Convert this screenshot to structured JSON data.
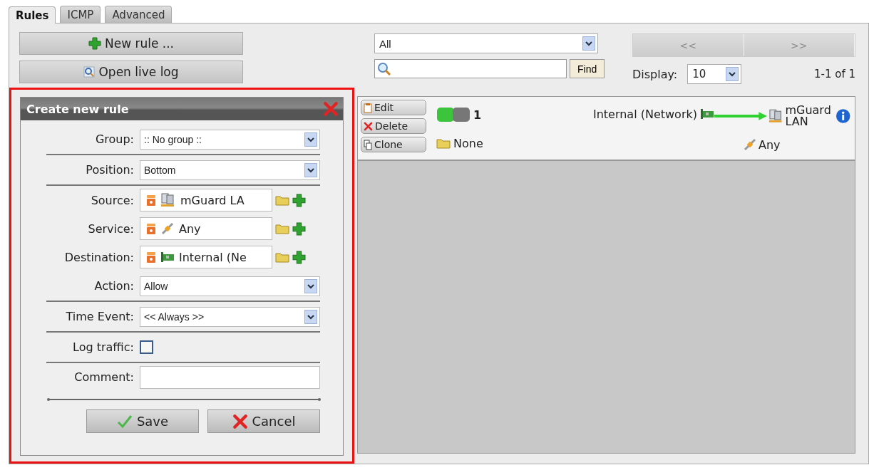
{
  "tabs": [
    {
      "label": "Rules",
      "selected": true
    },
    {
      "label": "ICMP",
      "selected": false
    },
    {
      "label": "Advanced",
      "selected": false
    }
  ],
  "new_rule_button": "New rule ...",
  "live_log_button": "Open live log",
  "filter": {
    "value": "All"
  },
  "search": {
    "button": "Find"
  },
  "pager": {
    "previous": "<<",
    "next": ">>",
    "disabled": true
  },
  "display": {
    "label": "Display:",
    "value": "10"
  },
  "count": "1-1 of 1",
  "rule": {
    "actions": [
      "Edit",
      "Delete",
      "Clone"
    ],
    "enabled": true,
    "number": "1",
    "source": "Internal (Network)",
    "destination": "mGuard LAN",
    "group": "None",
    "service": "Any"
  },
  "dialog": {
    "title": "Create new rule",
    "fields": [
      {
        "kind": "select",
        "label": "Group:",
        "value": ":: No group ::"
      },
      {
        "kind": "select",
        "label": "Position:",
        "value": "Bottom"
      },
      {
        "kind": "object",
        "label": "Source:",
        "value": "mGuard LA"
      },
      {
        "kind": "object",
        "label": "Service:",
        "value": "Any"
      },
      {
        "kind": "object",
        "label": "Destination:",
        "value": "Internal (Ne"
      },
      {
        "kind": "select",
        "label": "Action:",
        "value": "Allow"
      },
      {
        "kind": "select",
        "label": "Time Event:",
        "value": "<< Always >>"
      },
      {
        "kind": "checkbox",
        "label": "Log traffic:",
        "checked": false
      },
      {
        "kind": "text",
        "label": "Comment:"
      }
    ],
    "buttons": [
      "Save",
      "Cancel"
    ]
  }
}
